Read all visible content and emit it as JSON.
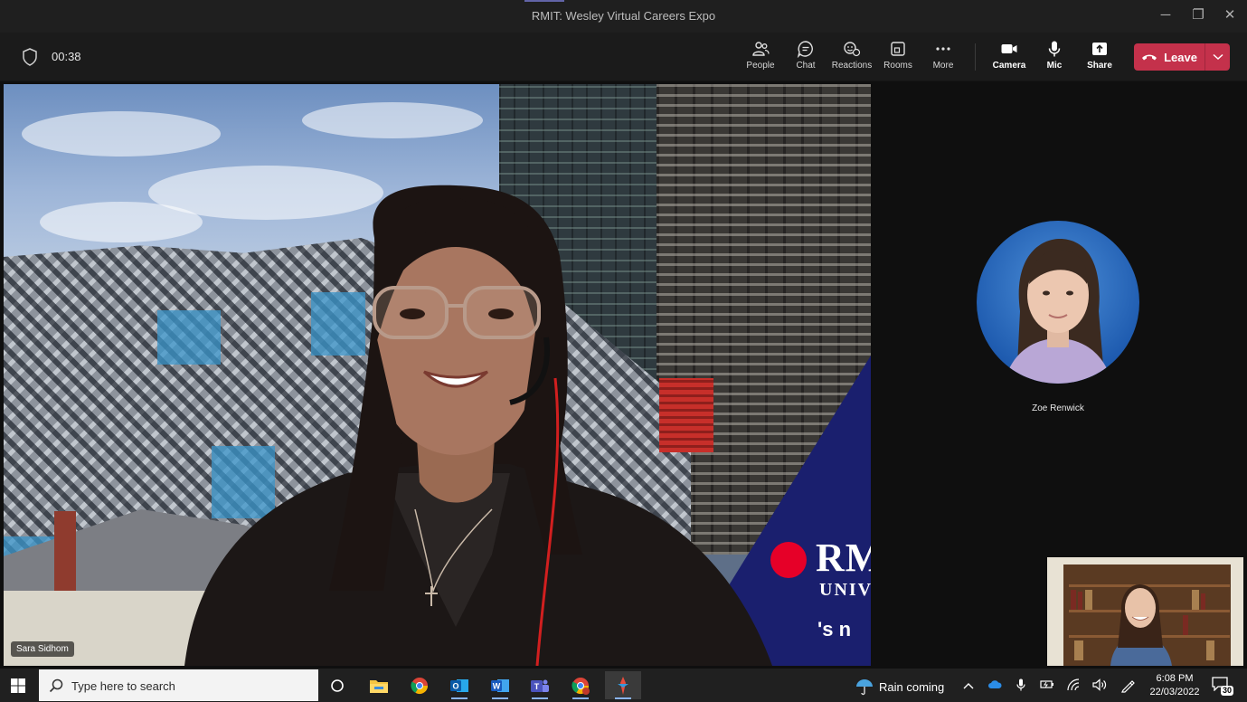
{
  "window": {
    "title": "RMIT: Wesley Virtual Careers Expo",
    "minimize_label": "─",
    "restore_label": "❐",
    "close_label": "✕"
  },
  "meeting": {
    "timer": "00:38",
    "toolbar": {
      "people": "People",
      "chat": "Chat",
      "reactions": "Reactions",
      "rooms": "Rooms",
      "more": "More",
      "camera": "Camera",
      "mic": "Mic",
      "share": "Share",
      "leave": "Leave"
    },
    "colors": {
      "leave": "#c4314b",
      "accent": "#6264a7"
    }
  },
  "stage": {
    "presenter_name": "Sara Sidhom",
    "background_logo": "RM",
    "background_logo_line2": "UNIV",
    "background_tagline": "'s n"
  },
  "participants": {
    "avatar_name": "Zoe Renwick"
  },
  "taskbar": {
    "search_placeholder": "Type here to search",
    "weather": "Rain coming",
    "time": "6:08 PM",
    "date": "22/03/2022",
    "notification_count": "30",
    "apps": [
      "task-view",
      "file-explorer",
      "chrome",
      "outlook",
      "word",
      "teams",
      "chrome-profile",
      "pinned-app"
    ]
  }
}
